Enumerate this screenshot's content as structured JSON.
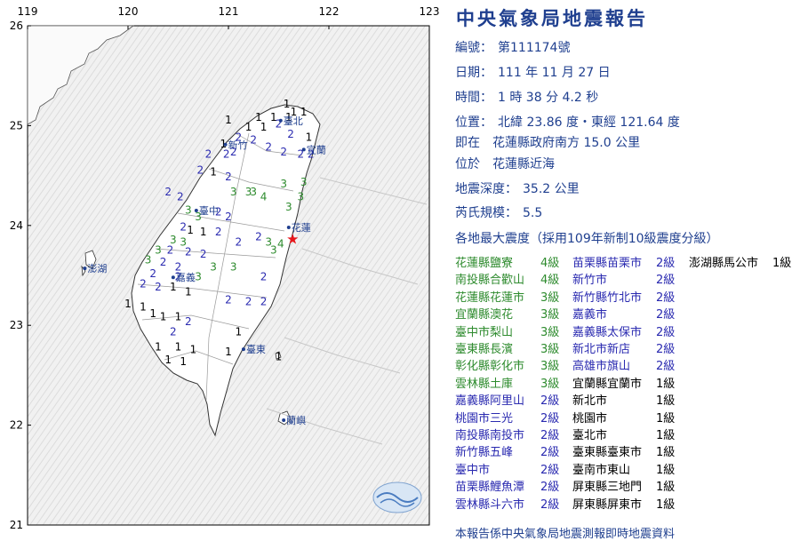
{
  "report": {
    "title": "中央氣象局地震報告",
    "number_label": "編號：",
    "number": "第111174號",
    "date_label": "日期：",
    "date": "111 年 11 月 27 日",
    "time_label": "時間：",
    "time": "1 時 38 分 4.2 秒",
    "position_label": "位置：",
    "position": "北緯 23.86 度・東經 121.64 度",
    "relative_pos": "即在　花蓮縣政府南方 15.0 公里",
    "located": "位於　花蓮縣近海",
    "depth_label": "地震深度：",
    "depth": "35.2 公里",
    "magnitude_label": "芮氏規模：",
    "magnitude": "5.5",
    "intensity_header": "各地最大震度（採用109年新制10級震度分級）",
    "footer": "本報告係中央氣象局地震測報即時地震資料"
  },
  "intensity_columns": [
    [
      {
        "loc": "花蓮縣鹽寮",
        "lvl": "4級",
        "color": "#2e8b2e"
      },
      {
        "loc": "南投縣合歡山",
        "lvl": "4級",
        "color": "#2e8b2e"
      },
      {
        "loc": "花蓮縣花蓮市",
        "lvl": "3級",
        "color": "#2e8b2e"
      },
      {
        "loc": "宜蘭縣澳花",
        "lvl": "3級",
        "color": "#2e8b2e"
      },
      {
        "loc": "臺中市梨山",
        "lvl": "3級",
        "color": "#2e8b2e"
      },
      {
        "loc": "臺東縣長濱",
        "lvl": "3級",
        "color": "#2e8b2e"
      },
      {
        "loc": "彰化縣彰化市",
        "lvl": "3級",
        "color": "#2e8b2e"
      },
      {
        "loc": "雲林縣土庫",
        "lvl": "3級",
        "color": "#2e8b2e"
      },
      {
        "loc": "嘉義縣阿里山",
        "lvl": "2級",
        "color": "#2a2ab0"
      },
      {
        "loc": "桃園市三光",
        "lvl": "2級",
        "color": "#2a2ab0"
      },
      {
        "loc": "南投縣南投市",
        "lvl": "2級",
        "color": "#2a2ab0"
      },
      {
        "loc": "新竹縣五峰",
        "lvl": "2級",
        "color": "#2a2ab0"
      },
      {
        "loc": "臺中市",
        "lvl": "2級",
        "color": "#2a2ab0"
      },
      {
        "loc": "苗栗縣鯉魚潭",
        "lvl": "2級",
        "color": "#2a2ab0"
      },
      {
        "loc": "雲林縣斗六市",
        "lvl": "2級",
        "color": "#2a2ab0"
      }
    ],
    [
      {
        "loc": "苗栗縣苗栗市",
        "lvl": "2級",
        "color": "#2a2ab0"
      },
      {
        "loc": "新竹市",
        "lvl": "2級",
        "color": "#2a2ab0"
      },
      {
        "loc": "新竹縣竹北市",
        "lvl": "2級",
        "color": "#2a2ab0"
      },
      {
        "loc": "嘉義市",
        "lvl": "2級",
        "color": "#2a2ab0"
      },
      {
        "loc": "嘉義縣太保市",
        "lvl": "2級",
        "color": "#2a2ab0"
      },
      {
        "loc": "新北市新店",
        "lvl": "2級",
        "color": "#2a2ab0"
      },
      {
        "loc": "高雄市旗山",
        "lvl": "2級",
        "color": "#2a2ab0"
      },
      {
        "loc": "宜蘭縣宜蘭市",
        "lvl": "1級",
        "color": "#000000"
      },
      {
        "loc": "新北市",
        "lvl": "1級",
        "color": "#000000"
      },
      {
        "loc": "桃園市",
        "lvl": "1級",
        "color": "#000000"
      },
      {
        "loc": "臺北市",
        "lvl": "1級",
        "color": "#000000"
      },
      {
        "loc": "臺東縣臺東市",
        "lvl": "1級",
        "color": "#000000"
      },
      {
        "loc": "臺南市東山",
        "lvl": "1級",
        "color": "#000000"
      },
      {
        "loc": "屏東縣三地門",
        "lvl": "1級",
        "color": "#000000"
      },
      {
        "loc": "屏東縣屏東市",
        "lvl": "1級",
        "color": "#000000"
      }
    ],
    [
      {
        "loc": "澎湖縣馬公市",
        "lvl": "1級",
        "color": "#000000"
      }
    ]
  ],
  "map": {
    "lon_ticks": [
      "119",
      "120",
      "121",
      "122",
      "123"
    ],
    "lat_ticks": [
      "26",
      "25",
      "24",
      "23",
      "22",
      "21"
    ],
    "cities": [
      {
        "name": "臺北",
        "lon": 121.52,
        "lat": 25.05
      },
      {
        "name": "新竹",
        "lon": 120.97,
        "lat": 24.81
      },
      {
        "name": "宜蘭",
        "lon": 121.75,
        "lat": 24.76
      },
      {
        "name": "臺中",
        "lon": 120.68,
        "lat": 24.15
      },
      {
        "name": "花蓮",
        "lon": 121.6,
        "lat": 23.98
      },
      {
        "name": "嘉義",
        "lon": 120.45,
        "lat": 23.48
      },
      {
        "name": "澎湖",
        "lon": 119.57,
        "lat": 23.57
      },
      {
        "name": "臺東",
        "lon": 121.15,
        "lat": 22.76
      },
      {
        "name": "蘭嶼",
        "lon": 121.55,
        "lat": 22.05
      }
    ],
    "epicenter": {
      "lon": 121.64,
      "lat": 23.86
    },
    "stations": [
      {
        "lon": 121.3,
        "lat": 25.05,
        "v": 1
      },
      {
        "lon": 121.45,
        "lat": 25.05,
        "v": 1
      },
      {
        "lon": 121.6,
        "lat": 25.05,
        "v": 1
      },
      {
        "lon": 121.65,
        "lat": 25.1,
        "v": 1
      },
      {
        "lon": 121.75,
        "lat": 25.1,
        "v": 1
      },
      {
        "lon": 121.58,
        "lat": 25.18,
        "v": 1
      },
      {
        "lon": 121.5,
        "lat": 24.98,
        "v": 2
      },
      {
        "lon": 121.35,
        "lat": 24.95,
        "v": 1
      },
      {
        "lon": 121.2,
        "lat": 24.95,
        "v": 1
      },
      {
        "lon": 121.0,
        "lat": 25.02,
        "v": 1
      },
      {
        "lon": 121.1,
        "lat": 24.85,
        "v": 2
      },
      {
        "lon": 120.95,
        "lat": 24.78,
        "v": 1
      },
      {
        "lon": 121.05,
        "lat": 24.7,
        "v": 2
      },
      {
        "lon": 120.98,
        "lat": 24.68,
        "v": 2
      },
      {
        "lon": 121.25,
        "lat": 24.82,
        "v": 2
      },
      {
        "lon": 121.4,
        "lat": 24.75,
        "v": 2
      },
      {
        "lon": 121.55,
        "lat": 24.7,
        "v": 2
      },
      {
        "lon": 121.72,
        "lat": 24.68,
        "v": 2
      },
      {
        "lon": 121.82,
        "lat": 24.68,
        "v": 2
      },
      {
        "lon": 121.8,
        "lat": 24.85,
        "v": 1
      },
      {
        "lon": 121.62,
        "lat": 24.88,
        "v": 2
      },
      {
        "lon": 120.8,
        "lat": 24.68,
        "v": 2
      },
      {
        "lon": 120.72,
        "lat": 24.52,
        "v": 2
      },
      {
        "lon": 120.85,
        "lat": 24.5,
        "v": 1
      },
      {
        "lon": 121.0,
        "lat": 24.45,
        "v": 2
      },
      {
        "lon": 121.2,
        "lat": 24.3,
        "v": 3
      },
      {
        "lon": 121.25,
        "lat": 24.3,
        "v": 3
      },
      {
        "lon": 121.35,
        "lat": 24.25,
        "v": 4
      },
      {
        "lon": 121.05,
        "lat": 24.3,
        "v": 3
      },
      {
        "lon": 121.55,
        "lat": 24.38,
        "v": 3
      },
      {
        "lon": 121.75,
        "lat": 24.4,
        "v": 3
      },
      {
        "lon": 121.72,
        "lat": 24.25,
        "v": 3
      },
      {
        "lon": 121.6,
        "lat": 24.15,
        "v": 3
      },
      {
        "lon": 120.4,
        "lat": 24.3,
        "v": 2
      },
      {
        "lon": 120.52,
        "lat": 24.25,
        "v": 2
      },
      {
        "lon": 120.6,
        "lat": 24.12,
        "v": 3
      },
      {
        "lon": 120.7,
        "lat": 24.05,
        "v": 3
      },
      {
        "lon": 120.9,
        "lat": 24.1,
        "v": 2
      },
      {
        "lon": 121.0,
        "lat": 24.05,
        "v": 2
      },
      {
        "lon": 120.55,
        "lat": 23.95,
        "v": 2
      },
      {
        "lon": 120.62,
        "lat": 23.92,
        "v": 1
      },
      {
        "lon": 120.75,
        "lat": 23.9,
        "v": 1
      },
      {
        "lon": 120.9,
        "lat": 23.9,
        "v": 2
      },
      {
        "lon": 121.1,
        "lat": 23.8,
        "v": 2
      },
      {
        "lon": 121.3,
        "lat": 23.85,
        "v": 2
      },
      {
        "lon": 121.4,
        "lat": 23.8,
        "v": 3
      },
      {
        "lon": 121.52,
        "lat": 23.78,
        "v": 4
      },
      {
        "lon": 121.45,
        "lat": 23.72,
        "v": 3
      },
      {
        "lon": 120.45,
        "lat": 23.82,
        "v": 3
      },
      {
        "lon": 120.55,
        "lat": 23.8,
        "v": 3
      },
      {
        "lon": 120.3,
        "lat": 23.72,
        "v": 3
      },
      {
        "lon": 120.42,
        "lat": 23.72,
        "v": 2
      },
      {
        "lon": 120.6,
        "lat": 23.7,
        "v": 2
      },
      {
        "lon": 120.75,
        "lat": 23.68,
        "v": 2
      },
      {
        "lon": 120.2,
        "lat": 23.62,
        "v": 3
      },
      {
        "lon": 120.35,
        "lat": 23.6,
        "v": 2
      },
      {
        "lon": 120.5,
        "lat": 23.55,
        "v": 2
      },
      {
        "lon": 120.25,
        "lat": 23.48,
        "v": 2
      },
      {
        "lon": 120.5,
        "lat": 23.45,
        "v": 2
      },
      {
        "lon": 120.7,
        "lat": 23.45,
        "v": 3
      },
      {
        "lon": 120.85,
        "lat": 23.55,
        "v": 3
      },
      {
        "lon": 121.05,
        "lat": 23.55,
        "v": 3
      },
      {
        "lon": 121.35,
        "lat": 23.45,
        "v": 2
      },
      {
        "lon": 120.15,
        "lat": 23.38,
        "v": 2
      },
      {
        "lon": 120.3,
        "lat": 23.35,
        "v": 2
      },
      {
        "lon": 120.45,
        "lat": 23.35,
        "v": 1
      },
      {
        "lon": 120.6,
        "lat": 23.3,
        "v": 1
      },
      {
        "lon": 121.0,
        "lat": 23.22,
        "v": 2
      },
      {
        "lon": 121.2,
        "lat": 23.2,
        "v": 2
      },
      {
        "lon": 121.35,
        "lat": 23.2,
        "v": 2
      },
      {
        "lon": 120.0,
        "lat": 23.18,
        "v": 1
      },
      {
        "lon": 120.15,
        "lat": 23.15,
        "v": 1
      },
      {
        "lon": 120.25,
        "lat": 23.08,
        "v": 1
      },
      {
        "lon": 120.35,
        "lat": 23.05,
        "v": 1
      },
      {
        "lon": 120.5,
        "lat": 23.05,
        "v": 1
      },
      {
        "lon": 120.6,
        "lat": 23.0,
        "v": 2
      },
      {
        "lon": 121.1,
        "lat": 22.9,
        "v": 1
      },
      {
        "lon": 120.45,
        "lat": 22.9,
        "v": 2
      },
      {
        "lon": 120.3,
        "lat": 22.75,
        "v": 1
      },
      {
        "lon": 120.5,
        "lat": 22.75,
        "v": 1
      },
      {
        "lon": 120.65,
        "lat": 22.72,
        "v": 1
      },
      {
        "lon": 120.4,
        "lat": 22.62,
        "v": 1
      },
      {
        "lon": 120.55,
        "lat": 22.6,
        "v": 1
      },
      {
        "lon": 121.0,
        "lat": 22.7,
        "v": 1
      },
      {
        "lon": 121.5,
        "lat": 22.65,
        "v": 1
      }
    ]
  }
}
